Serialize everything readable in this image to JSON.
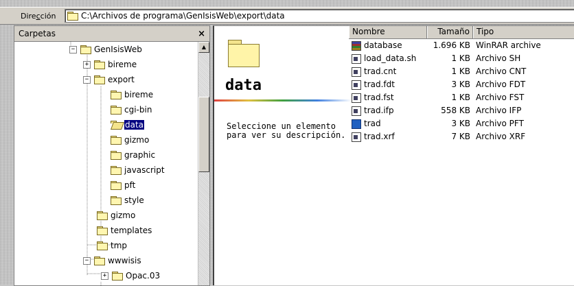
{
  "address": {
    "label_prefix": "Dire",
    "label_accel": "c",
    "label_suffix": "ción",
    "path": "C:\\Archivos de programa\\GenIsisWeb\\export\\data"
  },
  "left_pane": {
    "title": "Carpetas",
    "close_glyph": "×",
    "tree": [
      {
        "label": "GenIsisWeb",
        "expander": "−"
      },
      {
        "label": "bireme",
        "expander": "+"
      },
      {
        "label": "export",
        "expander": "−"
      },
      {
        "label": "bireme",
        "expander": ""
      },
      {
        "label": "cgi-bin",
        "expander": ""
      },
      {
        "label": "data",
        "expander": ""
      },
      {
        "label": "gizmo",
        "expander": ""
      },
      {
        "label": "graphic",
        "expander": ""
      },
      {
        "label": "javascript",
        "expander": ""
      },
      {
        "label": "pft",
        "expander": ""
      },
      {
        "label": "style",
        "expander": ""
      },
      {
        "label": "gizmo",
        "expander": ""
      },
      {
        "label": "templates",
        "expander": ""
      },
      {
        "label": "tmp",
        "expander": ""
      },
      {
        "label": "wwwisis",
        "expander": "−"
      },
      {
        "label": "Opac.03",
        "expander": "+"
      }
    ]
  },
  "right_pane": {
    "folder_title": "data",
    "description": "Seleccione un elemento para ver su descripción.",
    "columns": {
      "name": "Nombre",
      "size": "Tamaño",
      "type": "Tipo"
    },
    "files": [
      {
        "name": "database",
        "size": "1.696 KB",
        "type": "WinRAR archive",
        "icon": "rar"
      },
      {
        "name": "load_data.sh",
        "size": "1 KB",
        "type": "Archivo SH",
        "icon": "sh"
      },
      {
        "name": "trad.cnt",
        "size": "1 KB",
        "type": "Archivo CNT",
        "icon": "gen"
      },
      {
        "name": "trad.fdt",
        "size": "3 KB",
        "type": "Archivo FDT",
        "icon": "gen"
      },
      {
        "name": "trad.fst",
        "size": "1 KB",
        "type": "Archivo FST",
        "icon": "gen"
      },
      {
        "name": "trad.ifp",
        "size": "558 KB",
        "type": "Archivo IFP",
        "icon": "gen"
      },
      {
        "name": "trad",
        "size": "3 KB",
        "type": "Archivo PFT",
        "icon": "pft"
      },
      {
        "name": "trad.xrf",
        "size": "7 KB",
        "type": "Archivo XRF",
        "icon": "gen"
      }
    ]
  }
}
